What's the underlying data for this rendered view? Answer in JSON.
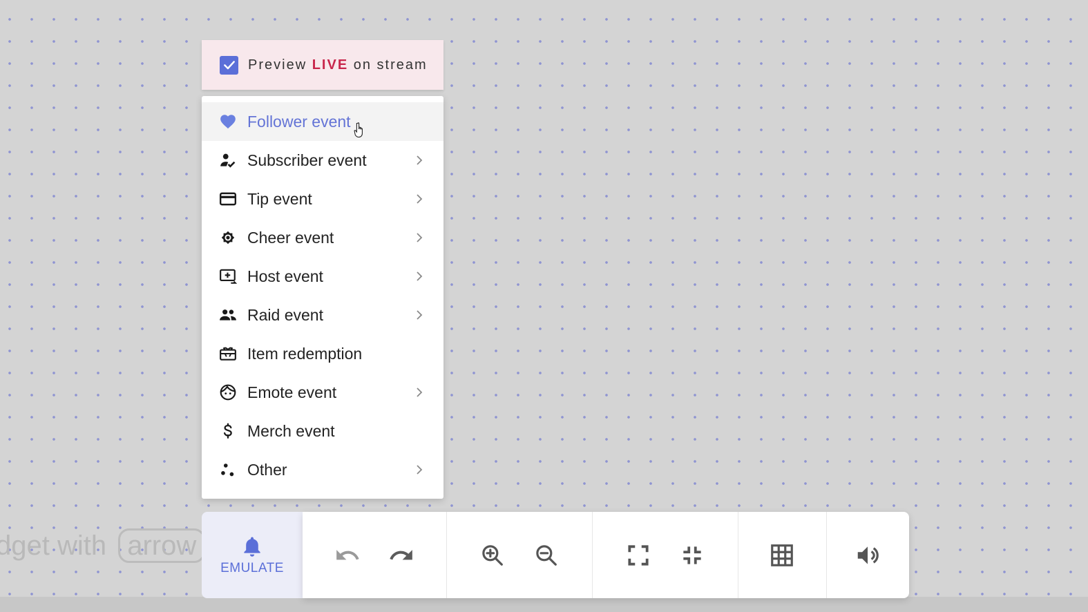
{
  "preview": {
    "checked": true,
    "label_prefix": "Preview",
    "label_live": "LIVE",
    "label_suffix": "on stream"
  },
  "menu": {
    "items": [
      {
        "label": "Follower event",
        "icon": "heart-icon",
        "has_submenu": false,
        "highlighted": true
      },
      {
        "label": "Subscriber event",
        "icon": "person-check-icon",
        "has_submenu": true
      },
      {
        "label": "Tip event",
        "icon": "credit-card-icon",
        "has_submenu": true
      },
      {
        "label": "Cheer event",
        "icon": "gear-badge-icon",
        "has_submenu": true
      },
      {
        "label": "Host event",
        "icon": "screen-add-icon",
        "has_submenu": true
      },
      {
        "label": "Raid event",
        "icon": "people-icon",
        "has_submenu": true
      },
      {
        "label": "Item redemption",
        "icon": "gift-card-icon",
        "has_submenu": false
      },
      {
        "label": "Emote event",
        "icon": "face-icon",
        "has_submenu": true
      },
      {
        "label": "Merch event",
        "icon": "dollar-icon",
        "has_submenu": false
      },
      {
        "label": "Other",
        "icon": "dots-icon",
        "has_submenu": true
      }
    ]
  },
  "toolbar": {
    "emulate_label": "EMULATE",
    "buttons": [
      "undo-icon",
      "redo-icon",
      "zoom-in-icon",
      "zoom-out-icon",
      "fullscreen-icon",
      "exit-fullscreen-icon",
      "grid-icon",
      "volume-icon"
    ]
  },
  "background_hint": {
    "text": "dget with",
    "key": "arrow"
  },
  "colors": {
    "accent": "#5b6fd8",
    "live": "#c8264c",
    "highlight_text": "#6474d6"
  }
}
